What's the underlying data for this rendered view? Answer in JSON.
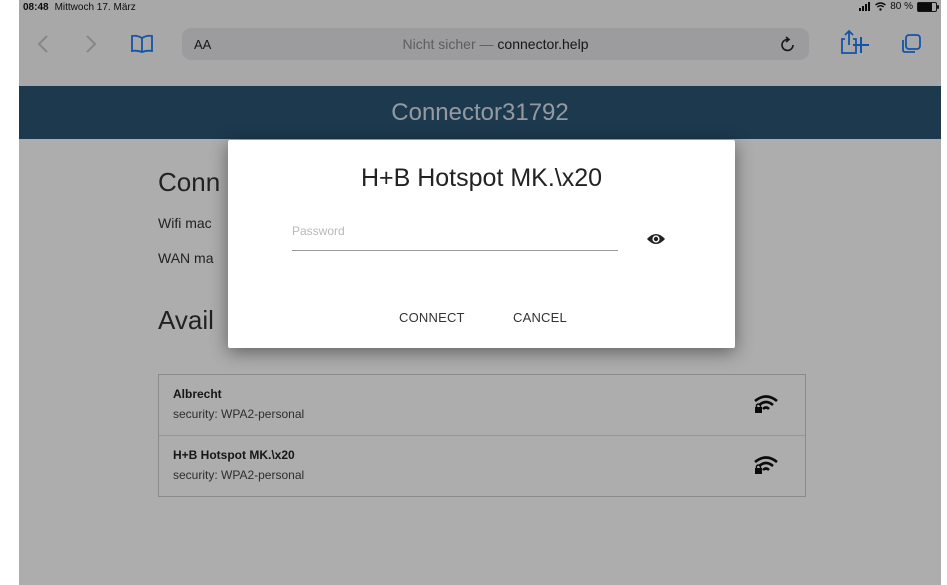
{
  "status_bar": {
    "time": "08:48",
    "date": "Mittwoch 17. März",
    "battery": "80 %",
    "battery_level": 0.8
  },
  "browser": {
    "reader_label": "AA",
    "url_prefix": "Nicht sicher —",
    "url_domain": "connector.help",
    "icons": {
      "back": "chevron-left-icon",
      "forward": "chevron-right-icon",
      "bookmarks": "book-icon",
      "reload": "reload-icon",
      "share": "share-icon",
      "new_tab": "plus-icon",
      "tabs": "tabs-icon"
    }
  },
  "page": {
    "header_title": "Connector31792",
    "connection_title": "Conn",
    "wifi_mac_label": "Wifi mac",
    "wan_mac_label": "WAN ma",
    "available_title": "Avail",
    "networks": [
      {
        "name": "Albrecht",
        "security": "security: WPA2-personal"
      },
      {
        "name": "H+B Hotspot MK.\\x20",
        "security": "security: WPA2-personal"
      }
    ]
  },
  "dialog": {
    "title": "H+B Hotspot MK.\\x20",
    "password_placeholder": "Password",
    "password_value": "",
    "connect_label": "CONNECT",
    "cancel_label": "CANCEL"
  },
  "colors": {
    "header_bg": "#2c5574",
    "accent_blue": "#1e7cf7",
    "overlay": "rgba(0,0,0,0.32)"
  }
}
